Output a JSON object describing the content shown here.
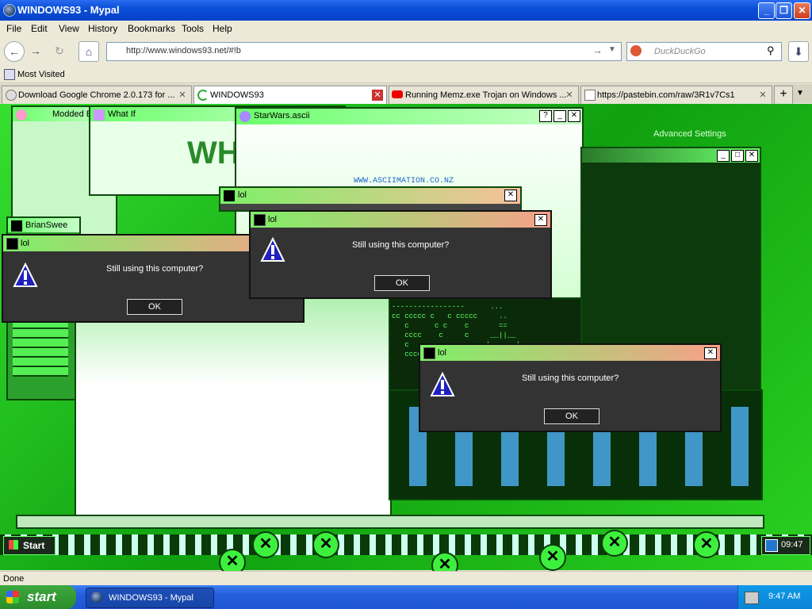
{
  "window": {
    "title": "WINDOWS93 - Mypal"
  },
  "menu": [
    "File",
    "Edit",
    "View",
    "History",
    "Bookmarks",
    "Tools",
    "Help"
  ],
  "nav": {
    "url": "http://www.windows93.net/#!b",
    "search_placeholder": "DuckDuckGo"
  },
  "bookmarks": {
    "most_visited": "Most Visited"
  },
  "tabs": [
    {
      "label": "Download Google Chrome 2.0.173 for ..."
    },
    {
      "label": "WINDOWS93"
    },
    {
      "label": "Running Memz.exe Trojan on Windows ..."
    },
    {
      "label": "https://pastebin.com/raw/3R1v7Cs1"
    }
  ],
  "w93": {
    "modded": "Modded E",
    "whatif": "What If",
    "starwars": "StarWars.ascii",
    "brian": "BrianSwee",
    "advanced": "Advanced Settings",
    "ascii_url": "WWW.ASCIIMATION.CO.NZ",
    "lol": "lol",
    "start": "Start",
    "clock": "09:47",
    "big_text": "WH"
  },
  "dialogs": [
    {
      "title": "lol",
      "message": "Still using this computer?",
      "ok": "OK"
    },
    {
      "title": "lol",
      "message": "Still using this computer?",
      "ok": "OK"
    },
    {
      "title": "lol",
      "message": "Still using this computer?",
      "ok": "OK"
    }
  ],
  "status": "Done",
  "taskbar": {
    "start": "start",
    "window": "WINDOWS93 - Mypal",
    "clock": "9:47 AM"
  }
}
